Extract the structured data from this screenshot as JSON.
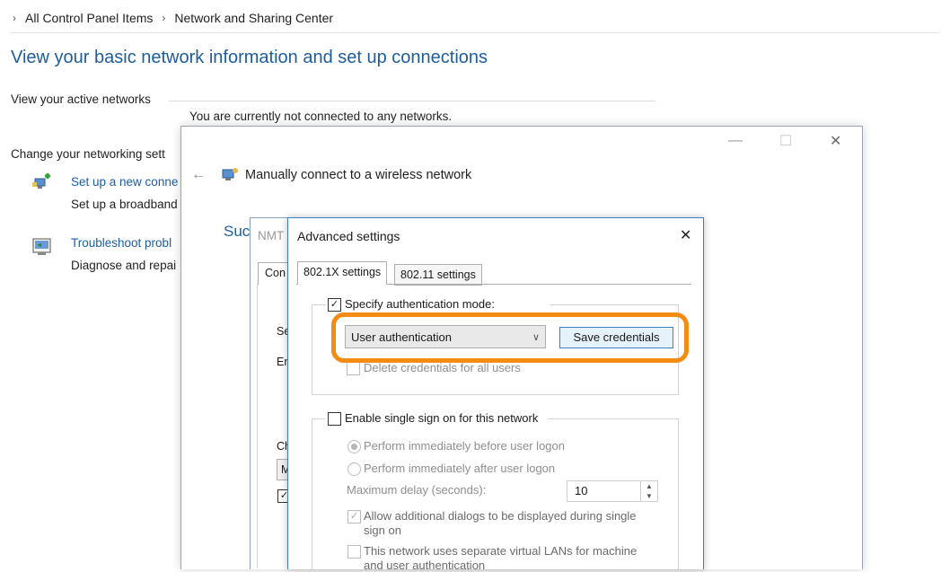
{
  "breadcrumb": {
    "items": [
      "All Control Panel Items",
      "Network and Sharing Center"
    ]
  },
  "main": {
    "title": "View your basic network information and set up connections",
    "active_networks_label": "View your active networks",
    "not_connected_text": "You are currently not connected to any networks.",
    "change_settings_label": "Change your networking sett",
    "tasks": [
      {
        "link": "Set up a new conne",
        "desc": "Set up a broadband",
        "icon": "network-setup-icon"
      },
      {
        "link": "Troubleshoot probl",
        "desc": "Diagnose and repai",
        "icon": "troubleshoot-icon"
      }
    ]
  },
  "wizard": {
    "title": "Manually connect to a wireless network",
    "back_glyph": "←",
    "minimize_glyph": "—",
    "maximize_glyph": "☐",
    "close_glyph": "✕",
    "partial_heading": "Suc"
  },
  "props_dialog": {
    "title_partial": "NMT",
    "tab_partial": "Con",
    "partial_labels": [
      "Se",
      "En",
      "Ch",
      "M"
    ]
  },
  "advanced": {
    "title": "Advanced settings",
    "close_glyph": "✕",
    "tabs": [
      "802.1X settings",
      "802.11 settings"
    ],
    "specify_auth_label": "Specify authentication mode:",
    "specify_auth_checked": true,
    "auth_mode_value": "User authentication",
    "save_credentials_label": "Save credentials",
    "delete_credentials_label": "Delete credentials for all users",
    "sso_label": "Enable single sign on for this network",
    "sso_checked": false,
    "radio_before_label": "Perform immediately before user logon",
    "radio_after_label": "Perform immediately after user logon",
    "max_delay_label": "Maximum delay (seconds):",
    "max_delay_value": "10",
    "allow_dialogs_line1": "Allow additional dialogs to be displayed during single",
    "allow_dialogs_line2": "sign on",
    "vlan_line1": "This network uses separate virtual LANs for machine",
    "vlan_line2": "and user authentication"
  },
  "colors": {
    "link": "#1e5da4",
    "title": "#1e5d9c",
    "highlight": "#f28c12",
    "dialog_border": "#3c7fc3"
  }
}
